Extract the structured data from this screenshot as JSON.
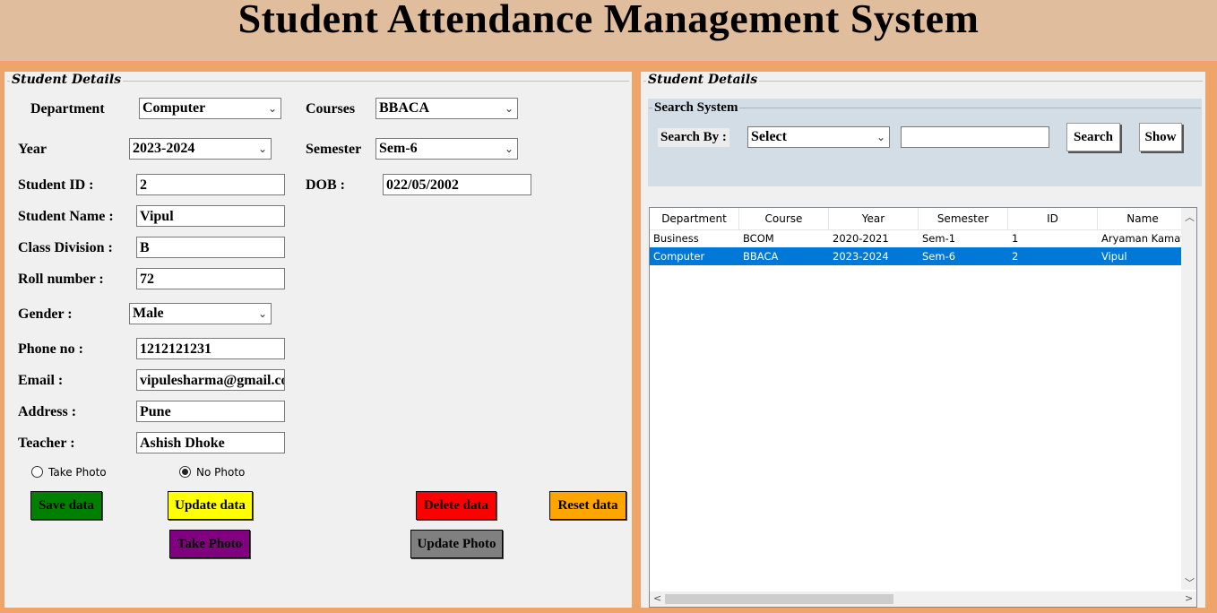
{
  "app": {
    "title": "Student Attendance Management System"
  },
  "left_panel": {
    "legend": "Student Details",
    "fields": {
      "department": {
        "label": "Department",
        "value": "Computer"
      },
      "courses": {
        "label": "Courses",
        "value": "BBACA"
      },
      "year": {
        "label": "Year",
        "value": "2023-2024"
      },
      "semester": {
        "label": "Semester",
        "value": "Sem-6"
      },
      "student_id": {
        "label": "Student ID :",
        "value": "2"
      },
      "dob": {
        "label": "DOB :",
        "value": "022/05/2002"
      },
      "student_name": {
        "label": "Student Name :",
        "value": "Vipul"
      },
      "class_division": {
        "label": "Class Division :",
        "value": "B"
      },
      "roll_number": {
        "label": "Roll number :",
        "value": "72"
      },
      "gender": {
        "label": "Gender :",
        "value": "Male"
      },
      "phone": {
        "label": "Phone no :",
        "value": "1212121231"
      },
      "email": {
        "label": "Email :",
        "value": "vipulesharma@gmail.co"
      },
      "address": {
        "label": "Address :",
        "value": "Pune"
      },
      "teacher": {
        "label": "Teacher :",
        "value": "Ashish Dhoke"
      }
    },
    "radios": {
      "take_photo": "Take Photo",
      "no_photo": "No Photo",
      "selected": "no_photo"
    },
    "buttons": {
      "save": "Save data",
      "update": "Update data",
      "delete": "Delete data",
      "reset": "Reset data",
      "take_photo": "Take Photo",
      "update_photo": "Update Photo"
    },
    "colors": {
      "save": "#008000",
      "update": "#ffff00",
      "delete": "#ff0000",
      "reset": "#ffa500",
      "take_photo": "#800080",
      "update_photo": "#808080"
    }
  },
  "right_panel": {
    "legend": "Student Details",
    "search": {
      "legend": "Search System",
      "search_by_label": "Search By :",
      "search_by_value": "Select",
      "search_text": "",
      "search_button": "Search",
      "show_button": "Show"
    },
    "table": {
      "columns": [
        "Department",
        "Course",
        "Year",
        "Semester",
        "ID",
        "Name"
      ],
      "rows": [
        [
          "Business",
          "BCOM",
          "2020-2021",
          "Sem-1",
          "1",
          "Aryaman Kamat"
        ],
        [
          "Computer",
          "BBACA",
          "2023-2024",
          "Sem-6",
          "2",
          "Vipul"
        ]
      ],
      "selected_row": 1
    }
  }
}
